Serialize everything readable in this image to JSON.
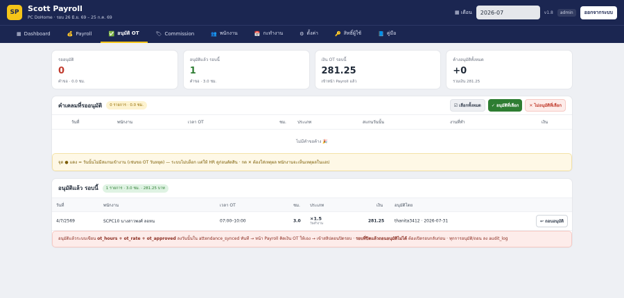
{
  "app": {
    "logo": "SP",
    "title": "Scott Payroll",
    "subtitle": "PC DoHome · รอบ 26 มิ.ย. 69 – 25 ก.ค. 69"
  },
  "topbar": {
    "month_label": "เดือน",
    "month_value": "2026-07",
    "version": "v1.8",
    "user": "admin",
    "logout_label": "ออกจากระบบ"
  },
  "nav": [
    {
      "label": "Dashboard",
      "icon": "dashboard-icon",
      "glyph": "▦"
    },
    {
      "label": "Payroll",
      "icon": "moneybag-icon",
      "glyph": "💰"
    },
    {
      "label": "อนุมัติ OT",
      "icon": "check-icon",
      "glyph": "✅"
    },
    {
      "label": "Commission",
      "icon": "tag-icon",
      "glyph": "🏷"
    },
    {
      "label": "พนักงาน",
      "icon": "people-icon",
      "glyph": "👥"
    },
    {
      "label": "กะทำงาน",
      "icon": "calendar-icon",
      "glyph": "📅"
    },
    {
      "label": "ตั้งค่า",
      "icon": "gear-icon",
      "glyph": "⚙"
    },
    {
      "label": "สิทธิ์ผู้ใช้",
      "icon": "key-icon",
      "glyph": "🔑"
    },
    {
      "label": "คู่มือ",
      "icon": "book-icon",
      "glyph": "📘"
    }
  ],
  "stats": [
    {
      "label": "รออนุมัติ",
      "value": "0",
      "sub": "คำขอ · 0.0 ชม."
    },
    {
      "label": "อนุมัติแล้ว รอบนี้",
      "value": "1",
      "sub": "คำขอ · 3.0 ชม."
    },
    {
      "label": "เงิน OT รอบนี้",
      "value": "281.25",
      "sub": "เข้าหน้า Payroll แล้ว"
    },
    {
      "label": "ค้างอนุมัติทั้งหมด",
      "value": "+0",
      "sub": "รวมเงิน 281.25"
    }
  ],
  "pending": {
    "title": "คำเคลมที่รออนุมัติ",
    "pill": "0 รายการ · 0.0 ชม.",
    "select_all": "☑ เลือกทั้งหมด",
    "approve": "✓ อนุมัติที่เลือก",
    "reject": "✕ ไม่อนุมัติที่เลือก",
    "columns": [
      "วันที่",
      "พนักงาน",
      "เวลา OT",
      "ชม.",
      "ประเภท",
      "สแกนวันนั้น",
      "งานที่ทำ",
      "เงิน"
    ],
    "empty_text": "ไม่มีคำขอค้าง 🎉",
    "note": "จุด ● แดง = วันนั้นไม่มีสแกนเข้างาน (เช่นขอ OT วันหยุด) — ระบบไม่บล็อก แต่ให้ HR ดูก่อนตัดสิน · กด ✕ ต้องใส่เหตุผล พนักงานจะเห็นเหตุผลในแอป"
  },
  "approved": {
    "title": "อนุมัติแล้ว รอบนี้",
    "pill": "1 รายการ · 3.0 ชม. · 281.25 บาท",
    "columns": [
      "วันที่",
      "พนักงาน",
      "เวลา OT",
      "ชม.",
      "ประเภท",
      "เงิน",
      "อนุมัติโดย"
    ],
    "rows": [
      {
        "date": "4/7/2569",
        "employee": "SCPC10 นางสาวพงศ์ ลอหน",
        "time": "07:00–10:00",
        "hours": "3.0",
        "type": "×1.5",
        "type_sub": "วันทำงาน",
        "amount": "281.25",
        "approver": "thanita3412 · 2026-07-31",
        "undo": "↩ ถอนอนุมัติ"
      }
    ],
    "note_parts": {
      "a": "อนุมัติแล้วระบบเขียน ",
      "b": "ot_hours + ot_rate + ot_approved",
      "c": " ลงวันนั้นใน attendance_synced ทันที → หน้า Payroll คิดเงิน OT ให้เอง → เข้าสลิปตอนปิดรอบ · ",
      "d": "รอบที่ปิดแล้วถอนอนุมัติไม่ได้",
      "e": " ต้องเปิดรอบกลับก่อน · ทุกการอนุมัติ/ถอน ลง audit_log"
    }
  },
  "colors": {
    "nav_bg": "#1b2651",
    "accent": "#f5c518",
    "red": "#c0392b",
    "green": "#2e7d32"
  }
}
